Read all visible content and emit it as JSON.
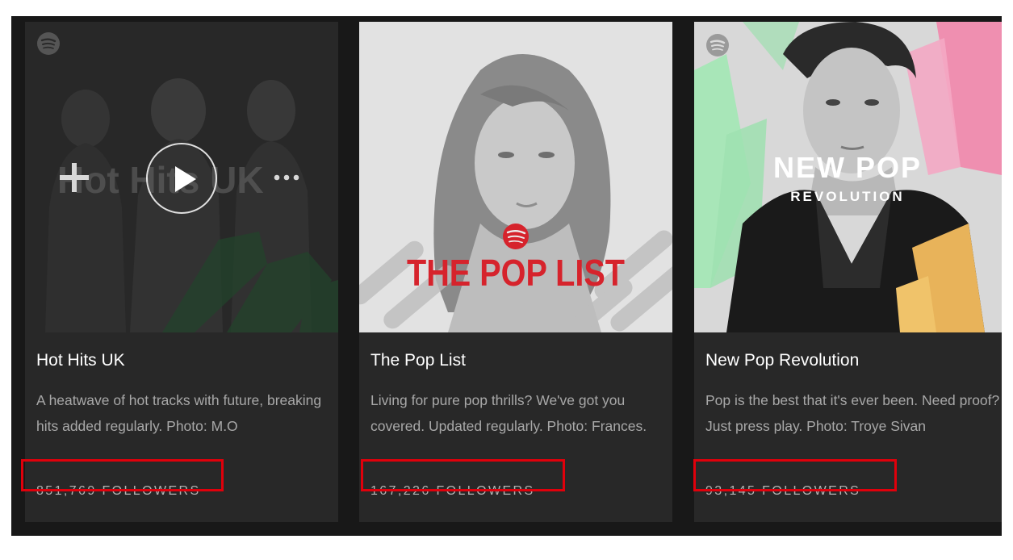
{
  "playlists": [
    {
      "title": "Hot Hits UK",
      "description": "A heatwave of hot tracks with future, breaking hits added regularly. Photo: M.O",
      "followers": "851,769 FOLLOWERS",
      "cover_text": "Hot Hits UK",
      "highlighted": true
    },
    {
      "title": "The Pop List",
      "description": "Living for pure pop thrills? We've got you covered. Updated regularly. Photo: Frances.",
      "followers": "167,226 FOLLOWERS",
      "cover_text": "THE POP LIST",
      "highlighted": true
    },
    {
      "title": "New Pop Revolution",
      "description": "Pop is the best that it's ever been. Need proof? Just press play. Photo: Troye Sivan",
      "followers": "93,145 FOLLOWERS",
      "cover_text_main": "NEW POP",
      "cover_text_sub": "REVOLUTION",
      "highlighted": true
    }
  ],
  "colors": {
    "highlight": "#e0000b",
    "card_bg": "#282828",
    "pop_list_red": "#d6232c"
  },
  "icons": [
    "spotify-logo-icon",
    "add-icon",
    "play-icon",
    "more-icon"
  ]
}
